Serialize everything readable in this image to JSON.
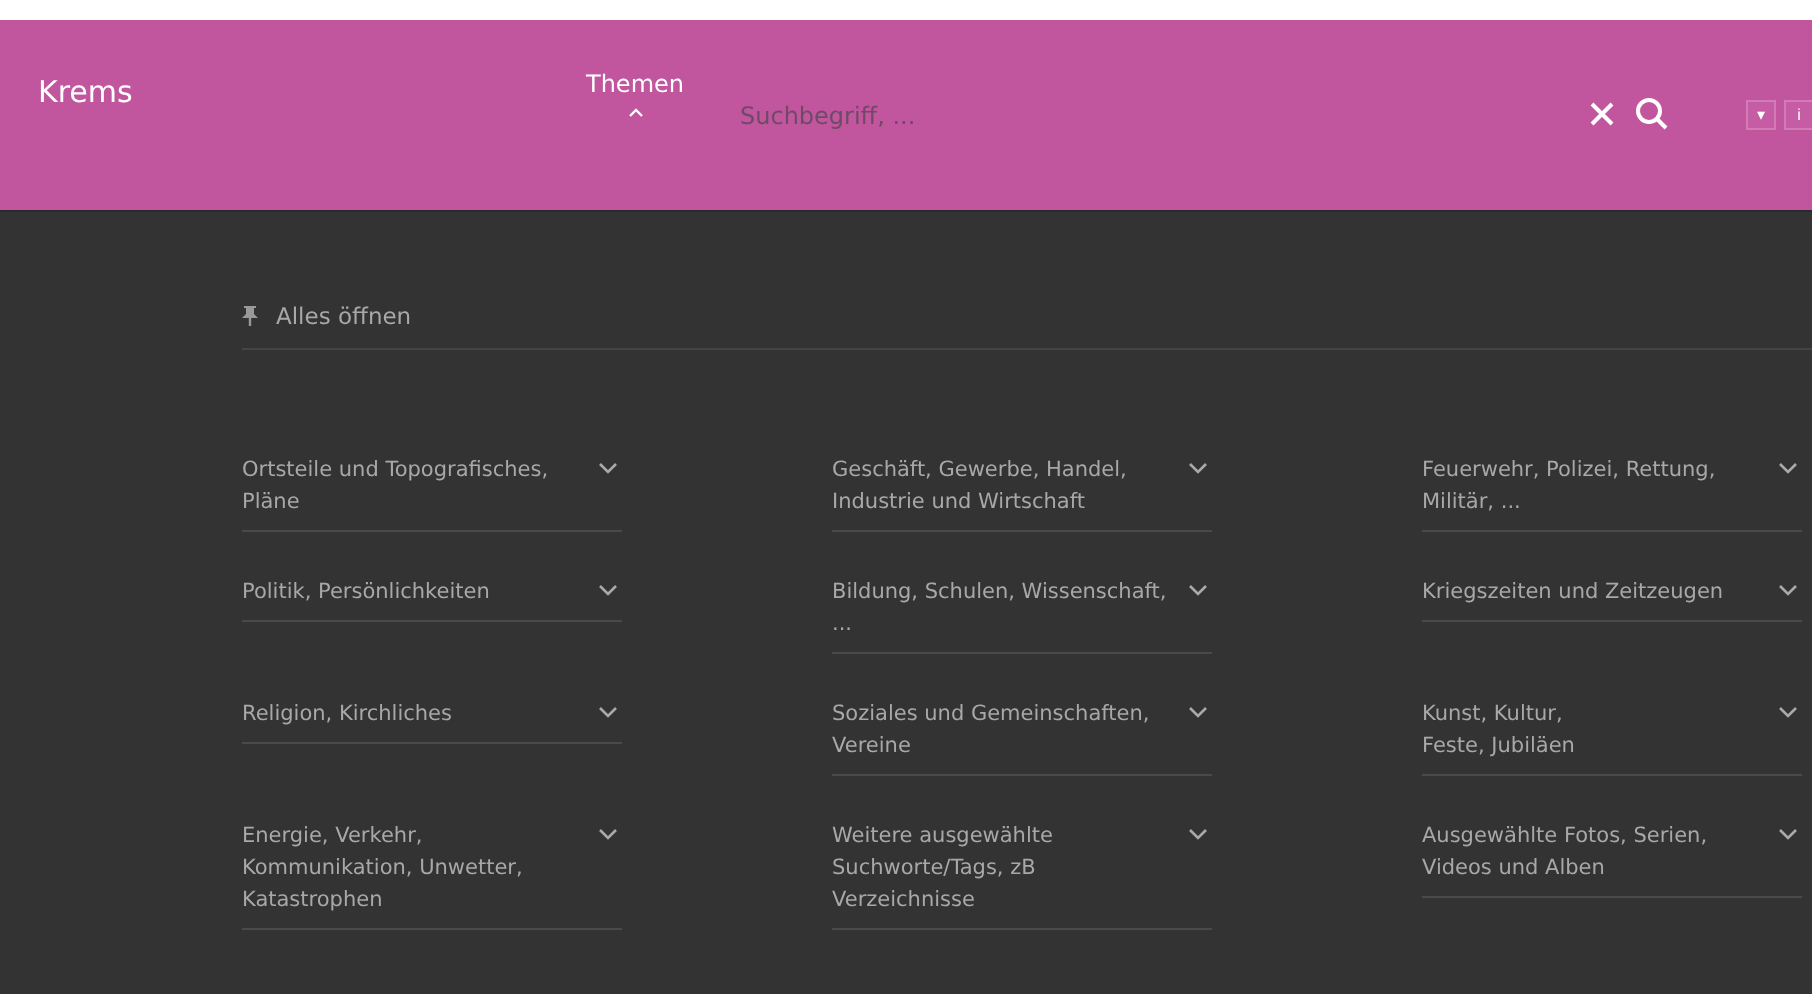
{
  "header": {
    "title": "Krems",
    "themes_label": "Themen",
    "themes_expanded": true,
    "search": {
      "placeholder": "Suchbegriff, ..."
    },
    "small_buttons": [
      "▾",
      "i"
    ]
  },
  "open_all": {
    "label": "Alles öffnen"
  },
  "topics": [
    {
      "label": "Ortsteile und Topografisches,\nPläne",
      "expanded": false
    },
    {
      "label": "Geschäft, Gewerbe, Handel,\nIndustrie und Wirtschaft",
      "expanded": false
    },
    {
      "label": "Feuerwehr, Polizei, Rettung,\nMilitär, ...",
      "expanded": false
    },
    {
      "label": "Politik, Persönlichkeiten",
      "expanded": false
    },
    {
      "label": "Bildung, Schulen, Wissenschaft,\n...",
      "expanded": false
    },
    {
      "label": "Kriegszeiten und Zeitzeugen",
      "expanded": false
    },
    {
      "label": "Religion, Kirchliches",
      "expanded": false
    },
    {
      "label": "Soziales und Gemeinschaften,\nVereine",
      "expanded": false
    },
    {
      "label": "Kunst, Kultur,\nFeste, Jubiläen",
      "expanded": false
    },
    {
      "label": "Energie, Verkehr,\nKommunikation, Unwetter,\nKatastrophen",
      "expanded": false
    },
    {
      "label": "Weitere ausgewählte\nSuchworte/Tags, zB\nVerzeichnisse",
      "expanded": false
    },
    {
      "label": "Ausgewählte Fotos, Serien,\nVideos und Alben",
      "expanded": false
    }
  ]
}
